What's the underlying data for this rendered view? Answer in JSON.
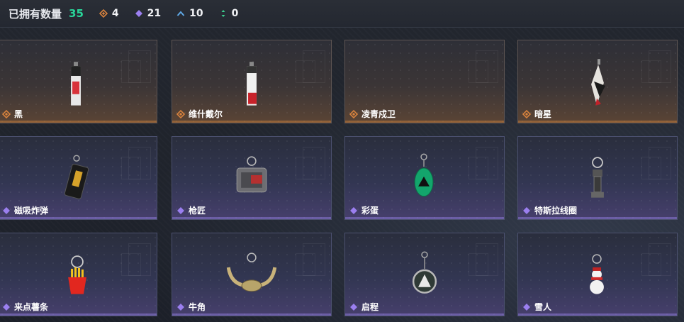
{
  "topbar": {
    "owned_label": "已拥有数量",
    "owned_count": "35",
    "stats": [
      {
        "icon": "orange-diamond-icon",
        "value": "4",
        "color": "#d9833e"
      },
      {
        "icon": "purple-diamond-icon",
        "value": "21",
        "color": "#9b7ff0"
      },
      {
        "icon": "blue-chevron-icon",
        "value": "10",
        "color": "#5fa8e6"
      },
      {
        "icon": "green-arrows-icon",
        "value": "0",
        "color": "#3ccf8e"
      }
    ]
  },
  "items": [
    {
      "name": "黑",
      "rarity": "orange",
      "icon": "black-tag-keychain"
    },
    {
      "name": "维什戴尔",
      "rarity": "orange",
      "icon": "red-tag-keychain"
    },
    {
      "name": "凌青戍卫",
      "rarity": "orange",
      "icon": "empty"
    },
    {
      "name": "暗星",
      "rarity": "orange",
      "icon": "feather-keychain"
    },
    {
      "name": "磁吸炸弹",
      "rarity": "purple",
      "icon": "bomb-keychain"
    },
    {
      "name": "枪匠",
      "rarity": "purple",
      "icon": "dogtag-keychain"
    },
    {
      "name": "彩蛋",
      "rarity": "purple",
      "icon": "green-egg-keychain"
    },
    {
      "name": "特斯拉线圈",
      "rarity": "purple",
      "icon": "tesla-coil-keychain"
    },
    {
      "name": "来点薯条",
      "rarity": "purple",
      "icon": "fries-keychain"
    },
    {
      "name": "牛角",
      "rarity": "purple",
      "icon": "horns-keychain"
    },
    {
      "name": "启程",
      "rarity": "purple",
      "icon": "medallion-keychain"
    },
    {
      "name": "雪人",
      "rarity": "purple",
      "icon": "snowman-keychain"
    }
  ]
}
